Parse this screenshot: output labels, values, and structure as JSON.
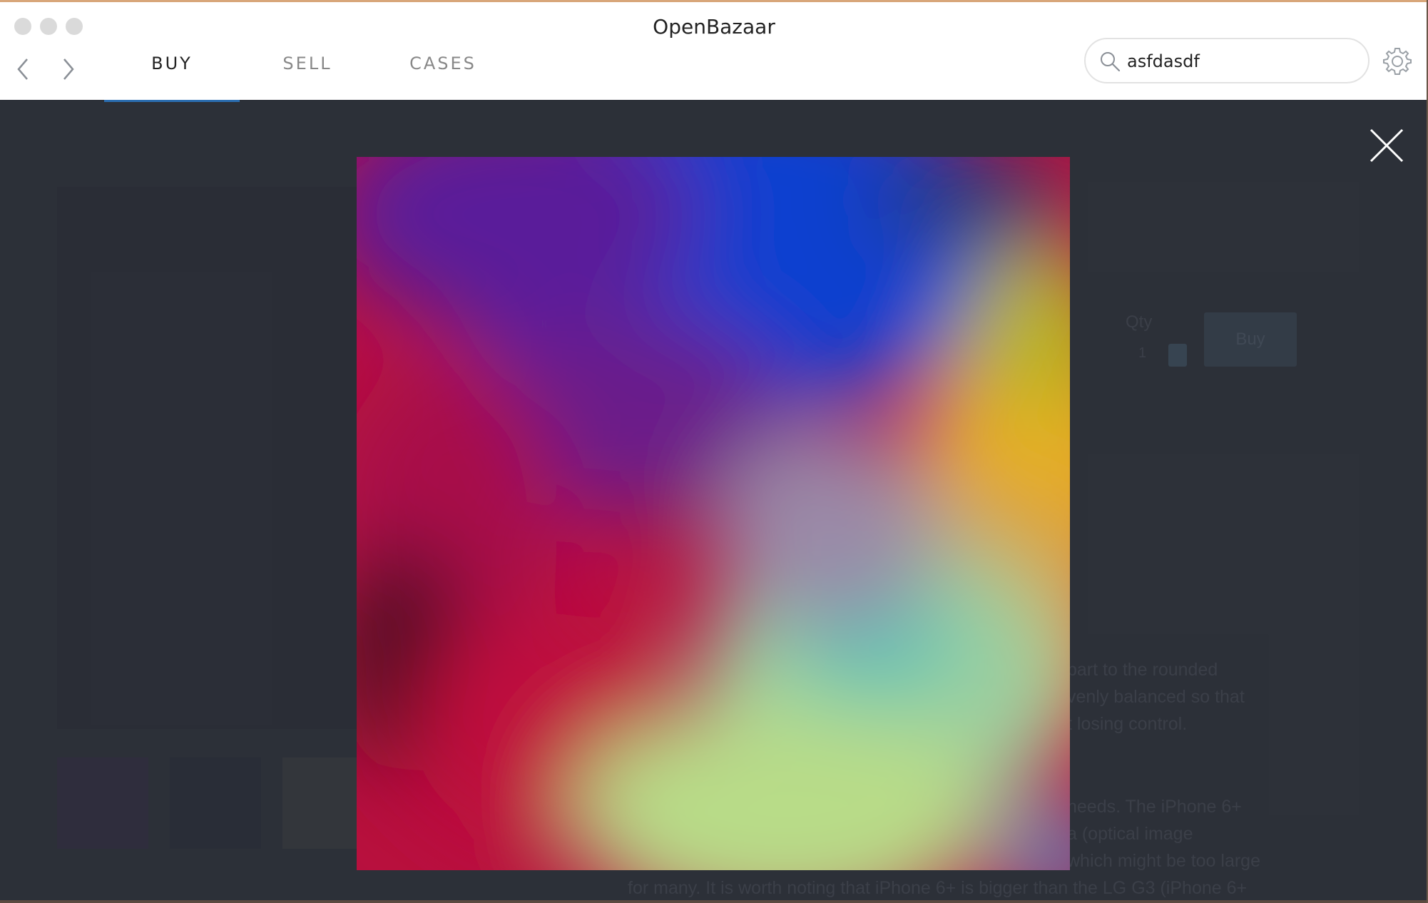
{
  "window": {
    "title": "OpenBazaar"
  },
  "nav": {
    "back_icon": "chevron-left-icon",
    "forward_icon": "chevron-right-icon"
  },
  "tabs": [
    {
      "label": "BUY",
      "active": true
    },
    {
      "label": "SELL",
      "active": false
    },
    {
      "label": "CASES",
      "active": false
    }
  ],
  "search": {
    "value": "asfdasdf",
    "icon": "search-icon"
  },
  "settings": {
    "icon": "gear-icon"
  },
  "listing": {
    "qty_label": "Qty",
    "qty_value": "1",
    "buy_label": "Buy",
    "description_lines": [
      "part to the rounded",
      "venly balanced so that",
      "t losing control.",
      "needs. The iPhone 6+",
      "a (optical image",
      "which might be too large",
      "for many. It is worth noting that iPhone 6+ is bigger than the LG G3 (iPhone 6+"
    ]
  },
  "lightbox": {
    "close_icon": "close-icon"
  },
  "colors": {
    "accent": "#2b6db0",
    "overlay": "#2f333b",
    "header_bg": "#ffffff"
  }
}
